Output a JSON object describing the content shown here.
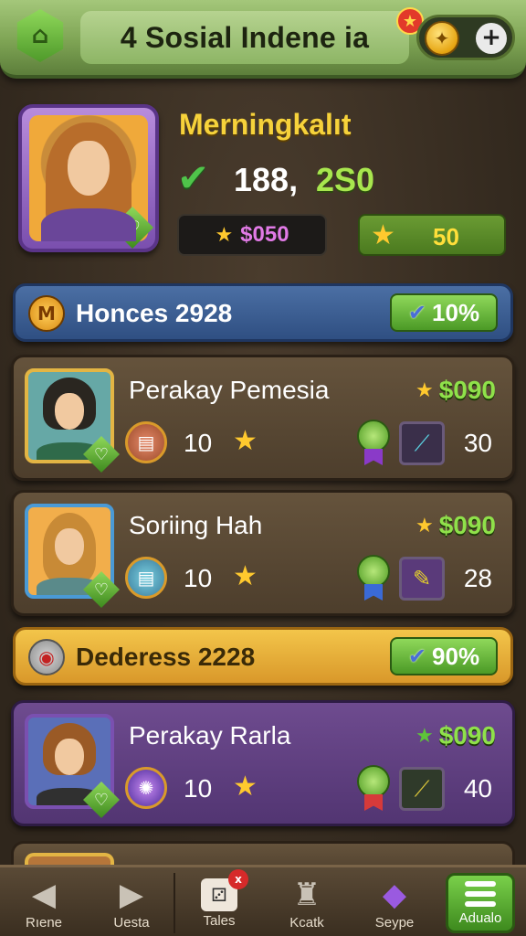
{
  "header": {
    "title": "4 Sosial Indene ia",
    "home_icon": "home-icon",
    "coin_icon": "coin-icon",
    "plus_label": "+"
  },
  "profile": {
    "name": "Merningkalıt",
    "stat_primary": "188,",
    "stat_secondary": "2S0",
    "currency_purple": "$050",
    "stars_green": "50"
  },
  "sections": [
    {
      "label": "Honces 2928",
      "percent": "10%"
    },
    {
      "label": "Dederess 2228",
      "percent": "90%"
    }
  ],
  "cards": [
    {
      "name": "Perakay Pemesia",
      "price": "$090",
      "count": "10",
      "level": "30"
    },
    {
      "name": "Soriing Hah",
      "price": "$090",
      "count": "10",
      "level": "28"
    },
    {
      "name": "Perakay Rarla",
      "price": "$090",
      "count": "10",
      "level": "40"
    }
  ],
  "bottom_nav": [
    {
      "label": "Rıene",
      "icon": "back-arrow-icon"
    },
    {
      "label": "Uesta",
      "icon": "forward-arrow-icon"
    },
    {
      "label": "Tales",
      "icon": "dice-icon",
      "badge": "x"
    },
    {
      "label": "Kcatk",
      "icon": "person-icon"
    },
    {
      "label": "Seype",
      "icon": "gem-icon"
    },
    {
      "label": "Adualo",
      "icon": "menu-icon"
    }
  ],
  "colors": {
    "header_green": "#7ea454",
    "accent_gold": "#f6d23b",
    "price_green": "#8fe14a",
    "banner_blue": "#3a5c92",
    "banner_gold": "#e6ac35",
    "card_purple": "#5f4080"
  }
}
